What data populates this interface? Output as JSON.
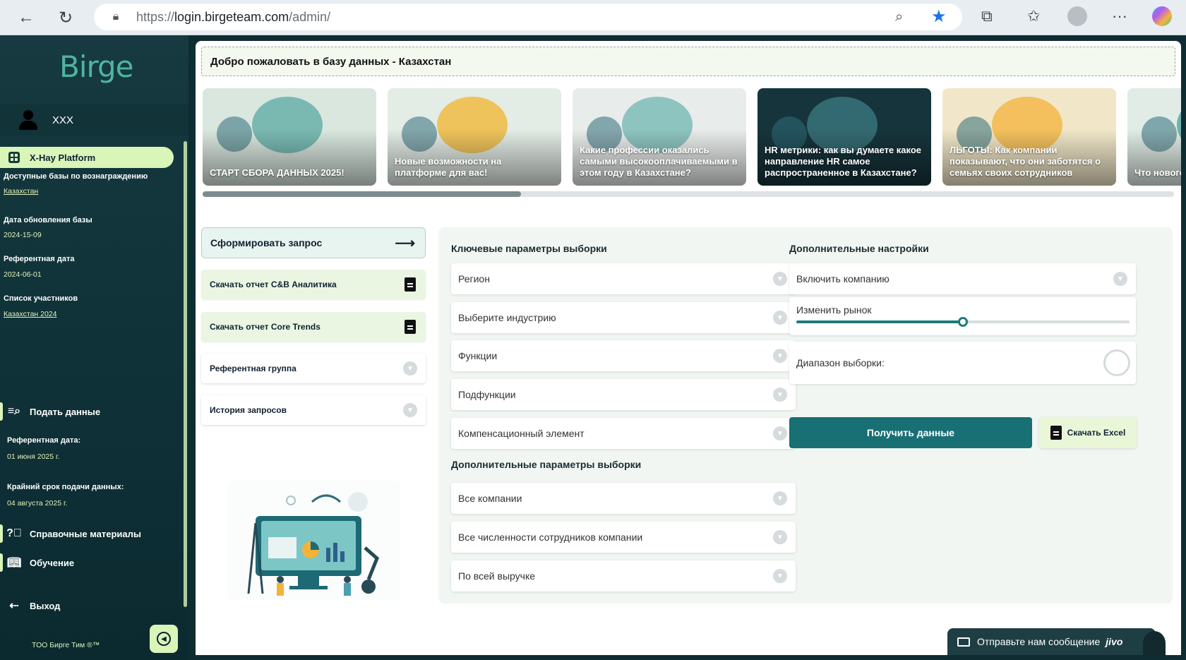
{
  "browser": {
    "url_scheme": "https://",
    "url_host": "login.birgeteam.com",
    "url_path": "/admin/"
  },
  "sidebar": {
    "logo": "Birge",
    "user_name": "XXX",
    "platform": "X-Hay Platform",
    "available_label": "Доступные базы по вознаграждению",
    "available_value": "Казахстан",
    "update_label": "Дата обновления базы",
    "update_value": "2024-15-09",
    "ref_label": "Референтная дата",
    "ref_value": "2024-06-01",
    "participants_label": "Список участников",
    "participants_value": "Казахстан 2024",
    "submit_label": "Подать данные",
    "submit_ref_label": "Референтная дата:",
    "submit_ref_value": "01 июня 2025 г.",
    "deadline_label": "Крайний срок подачи данных:",
    "deadline_value": "04 августа 2025 г.",
    "help_label": "Справочные материалы",
    "training_label": "Обучение",
    "logout_label": "Выход",
    "company": "ТОО Бирге Тим ®™"
  },
  "main": {
    "welcome": "Добро пожаловать в базу данных - Казахстан",
    "cards": [
      {
        "title": "СТАРТ СБОРА ДАННЫХ 2025!",
        "bg": "#d9e7df",
        "accent": "#58a9a3"
      },
      {
        "title": "Новые возможности на платформе для вас!",
        "bg": "#e4ece6",
        "accent": "#f2b52c"
      },
      {
        "title": "Какие профессии оказались самыми высокооплачиваемыми в этом году в Казахстане?",
        "bg": "#e8ecea",
        "accent": "#6fb7b0"
      },
      {
        "title": "HR метрики: как вы думаете какое направление HR самое распространенное в Казахстане?",
        "bg": "#16343b",
        "accent": "#3d7b83"
      },
      {
        "title": "ЛЬГОТЫ: Как компании показывают, что они заботятся о семьях своих сотрудников",
        "bg": "#f1e7c8",
        "accent": "#f3b33a"
      },
      {
        "title": "Что нового на платформе",
        "bg": "#e1ece6",
        "accent": "#4aa09a"
      }
    ],
    "form_request": "Сформировать запрос",
    "download_cb": "Скачать отчет C&B Аналитика",
    "download_core": "Скачать отчет Core Trends",
    "reference_group": "Референтная группа",
    "history": "История запросов"
  },
  "params": {
    "key_title": "Ключевые параметры выборки",
    "region": "Регион",
    "industry": "Выберите индустрию",
    "functions": "Функции",
    "subfunctions": "Подфункции",
    "comp_element": "Компенсационный элемент",
    "extra_title": "Дополнительные параметры выборки",
    "all_companies": "Все компании",
    "all_headcount": "Все численности сотрудников компании",
    "all_revenue": "По всей выручке",
    "settings_title": "Дополнительные настройки",
    "include_company": "Включить компанию",
    "change_market": "Изменить рынок",
    "market_slider_value": 0.5,
    "sample_range": "Диапазон выборки:",
    "get_data": "Получить данные",
    "download_excel": "Скачать Excel"
  },
  "chat": {
    "text": "Отправьте нам сообщение",
    "brand": "jivo"
  },
  "colors": {
    "sidebar_bg": "#0f3238",
    "accent_lime": "#d9f5b8",
    "primary_teal": "#186f74"
  }
}
